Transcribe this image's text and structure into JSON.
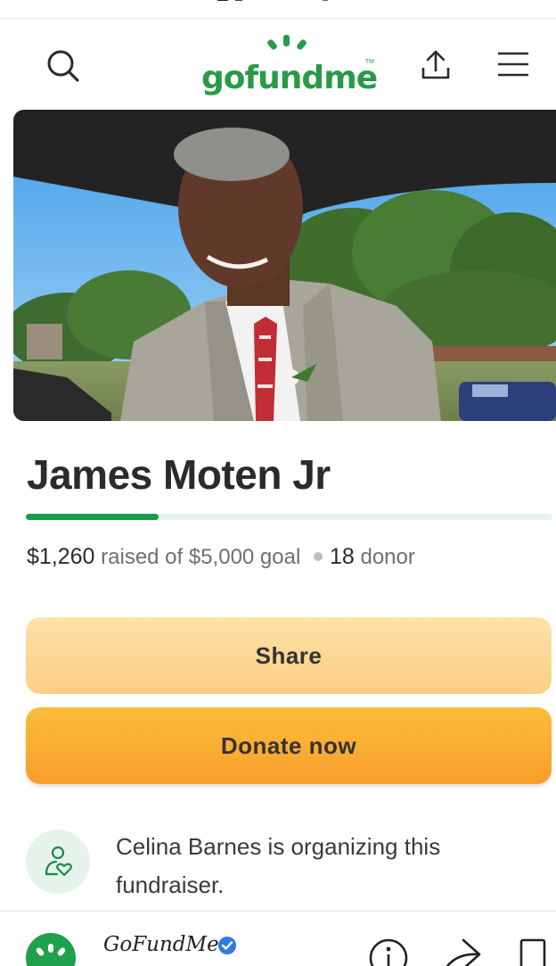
{
  "header": {
    "logo_text": "gofundme",
    "logo_tm": "TM",
    "icons": [
      "search-icon",
      "upload-icon",
      "menu-icon"
    ]
  },
  "campaign": {
    "title": "James Moten Jr",
    "raised": "$1,260",
    "raised_label": "raised of $5,000 goal",
    "donors_count": "18",
    "donors_label": "donor",
    "progress": 0.252,
    "progress_color": "#1a9a4d"
  },
  "actions": {
    "share_label": "Share",
    "donate_label": "Donate now"
  },
  "organizer": {
    "text": "Celina Barnes is organizing this fundraiser."
  },
  "bottom_bar": {
    "name": "GoFundMe",
    "icons": [
      "info-icon",
      "share-arrow-icon",
      "bookmark-icon"
    ]
  },
  "colors": {
    "brand_green": "#2a9a48",
    "share_button": "#fcd78f",
    "donate_button": "#f9ae31"
  }
}
